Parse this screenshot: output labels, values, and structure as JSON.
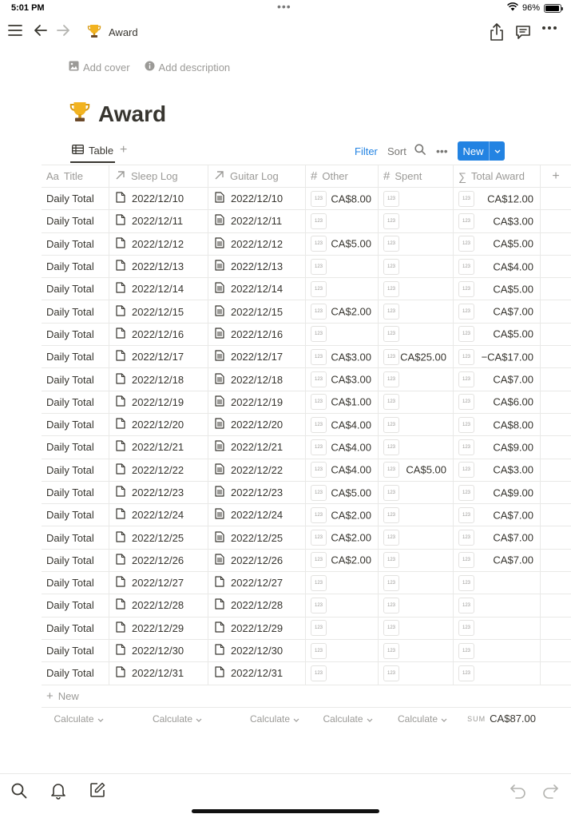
{
  "status_bar": {
    "time": "5:01 PM",
    "dots": "•••",
    "battery": "96%",
    "battery_level": 0.96
  },
  "breadcrumb": {
    "icon": "trophy-icon",
    "title": "Award"
  },
  "page": {
    "add_cover": "Add cover",
    "add_description": "Add description",
    "title": "Award",
    "icon": "trophy-icon"
  },
  "view": {
    "tab_label": "Table",
    "filter": "Filter",
    "sort": "Sort",
    "new_label": "New"
  },
  "table": {
    "columns": [
      {
        "key": "title",
        "label": "Title",
        "icon": "aa-icon"
      },
      {
        "key": "sleep",
        "label": "Sleep Log",
        "icon": "relation-arrow-icon"
      },
      {
        "key": "guitar",
        "label": "Guitar Log",
        "icon": "relation-arrow-icon"
      },
      {
        "key": "other",
        "label": "Other",
        "icon": "hash-icon"
      },
      {
        "key": "spent",
        "label": "Spent",
        "icon": "hash-icon"
      },
      {
        "key": "total",
        "label": "Total Award",
        "icon": "sigma-icon"
      }
    ],
    "badge_text": "123",
    "rows": [
      {
        "title": "Daily Total",
        "sleep": "2022/12/10",
        "guitar": "2022/12/10",
        "guitar_filled": true,
        "other": "CA$8.00",
        "spent": "",
        "total": "CA$12.00"
      },
      {
        "title": "Daily Total",
        "sleep": "2022/12/11",
        "guitar": "2022/12/11",
        "guitar_filled": true,
        "other": "",
        "spent": "",
        "total": "CA$3.00"
      },
      {
        "title": "Daily Total",
        "sleep": "2022/12/12",
        "guitar": "2022/12/12",
        "guitar_filled": true,
        "other": "CA$5.00",
        "spent": "",
        "total": "CA$5.00"
      },
      {
        "title": "Daily Total",
        "sleep": "2022/12/13",
        "guitar": "2022/12/13",
        "guitar_filled": true,
        "other": "",
        "spent": "",
        "total": "CA$4.00"
      },
      {
        "title": "Daily Total",
        "sleep": "2022/12/14",
        "guitar": "2022/12/14",
        "guitar_filled": true,
        "other": "",
        "spent": "",
        "total": "CA$5.00"
      },
      {
        "title": "Daily Total",
        "sleep": "2022/12/15",
        "guitar": "2022/12/15",
        "guitar_filled": true,
        "other": "CA$2.00",
        "spent": "",
        "total": "CA$7.00"
      },
      {
        "title": "Daily Total",
        "sleep": "2022/12/16",
        "guitar": "2022/12/16",
        "guitar_filled": true,
        "other": "",
        "spent": "",
        "total": "CA$5.00"
      },
      {
        "title": "Daily Total",
        "sleep": "2022/12/17",
        "guitar": "2022/12/17",
        "guitar_filled": true,
        "other": "CA$3.00",
        "spent": "CA$25.00",
        "total": "−CA$17.00"
      },
      {
        "title": "Daily Total",
        "sleep": "2022/12/18",
        "guitar": "2022/12/18",
        "guitar_filled": true,
        "other": "CA$3.00",
        "spent": "",
        "total": "CA$7.00"
      },
      {
        "title": "Daily Total",
        "sleep": "2022/12/19",
        "guitar": "2022/12/19",
        "guitar_filled": true,
        "other": "CA$1.00",
        "spent": "",
        "total": "CA$6.00"
      },
      {
        "title": "Daily Total",
        "sleep": "2022/12/20",
        "guitar": "2022/12/20",
        "guitar_filled": true,
        "other": "CA$4.00",
        "spent": "",
        "total": "CA$8.00"
      },
      {
        "title": "Daily Total",
        "sleep": "2022/12/21",
        "guitar": "2022/12/21",
        "guitar_filled": true,
        "other": "CA$4.00",
        "spent": "",
        "total": "CA$9.00"
      },
      {
        "title": "Daily Total",
        "sleep": "2022/12/22",
        "guitar": "2022/12/22",
        "guitar_filled": true,
        "other": "CA$4.00",
        "spent": "CA$5.00",
        "total": "CA$3.00"
      },
      {
        "title": "Daily Total",
        "sleep": "2022/12/23",
        "guitar": "2022/12/23",
        "guitar_filled": true,
        "other": "CA$5.00",
        "spent": "",
        "total": "CA$9.00"
      },
      {
        "title": "Daily Total",
        "sleep": "2022/12/24",
        "guitar": "2022/12/24",
        "guitar_filled": true,
        "other": "CA$2.00",
        "spent": "",
        "total": "CA$7.00"
      },
      {
        "title": "Daily Total",
        "sleep": "2022/12/25",
        "guitar": "2022/12/25",
        "guitar_filled": true,
        "other": "CA$2.00",
        "spent": "",
        "total": "CA$7.00"
      },
      {
        "title": "Daily Total",
        "sleep": "2022/12/26",
        "guitar": "2022/12/26",
        "guitar_filled": true,
        "other": "CA$2.00",
        "spent": "",
        "total": "CA$7.00"
      },
      {
        "title": "Daily Total",
        "sleep": "2022/12/27",
        "guitar": "2022/12/27",
        "guitar_filled": false,
        "other": "",
        "spent": "",
        "total": ""
      },
      {
        "title": "Daily Total",
        "sleep": "2022/12/28",
        "guitar": "2022/12/28",
        "guitar_filled": false,
        "other": "",
        "spent": "",
        "total": ""
      },
      {
        "title": "Daily Total",
        "sleep": "2022/12/29",
        "guitar": "2022/12/29",
        "guitar_filled": false,
        "other": "",
        "spent": "",
        "total": ""
      },
      {
        "title": "Daily Total",
        "sleep": "2022/12/30",
        "guitar": "2022/12/30",
        "guitar_filled": false,
        "other": "",
        "spent": "",
        "total": ""
      },
      {
        "title": "Daily Total",
        "sleep": "2022/12/31",
        "guitar": "2022/12/31",
        "guitar_filled": false,
        "other": "",
        "spent": "",
        "total": ""
      }
    ],
    "new_row_label": "New",
    "calculate_label": "Calculate",
    "sum_label": "SUM",
    "sum_value": "CA$87.00"
  },
  "colors": {
    "accent": "#2383e2",
    "text": "#37352f",
    "muted": "#9b9a97",
    "border": "#e9e9e7"
  }
}
